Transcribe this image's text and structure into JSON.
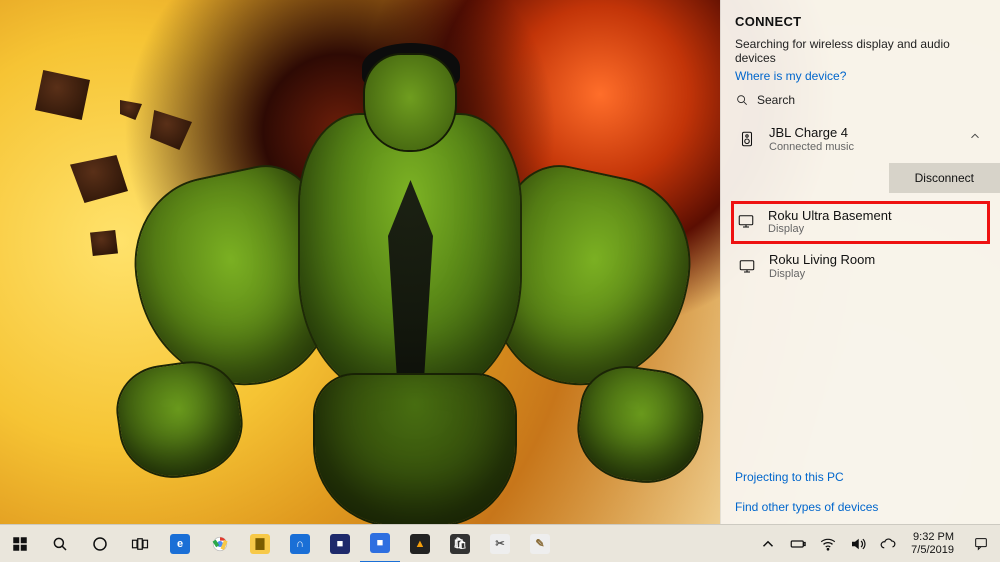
{
  "panel": {
    "title": "CONNECT",
    "status_text": "Searching for wireless display and audio devices",
    "where_link": "Where is my device?",
    "search_label": "Search",
    "connected_device": {
      "name": "JBL Charge 4",
      "sub": "Connected music"
    },
    "disconnect_label": "Disconnect",
    "devices": [
      {
        "name": "Roku Ultra Basement",
        "sub": "Display",
        "highlighted": true
      },
      {
        "name": "Roku Living Room",
        "sub": "Display",
        "highlighted": false
      }
    ],
    "projecting_link": "Projecting to this PC",
    "other_types_link": "Find other types of devices"
  },
  "taskbar": {
    "pinned": [
      {
        "name": "start",
        "glyph": "win",
        "color": "#111"
      },
      {
        "name": "search",
        "glyph": "search",
        "color": "#111"
      },
      {
        "name": "cortana",
        "glyph": "ring",
        "color": "#111"
      },
      {
        "name": "task-view",
        "glyph": "taskview",
        "color": "#111"
      },
      {
        "name": "edge",
        "glyph": "E",
        "color": "#1a6fd6"
      },
      {
        "name": "chrome",
        "glyph": "●",
        "color": "#fff"
      },
      {
        "name": "file-explorer",
        "glyph": "▇",
        "color": "#f7c948"
      },
      {
        "name": "app-blue",
        "glyph": "∩",
        "color": "#1a6fd6"
      },
      {
        "name": "app-dark",
        "glyph": "■",
        "color": "#1e2a6b"
      },
      {
        "name": "app-blue2",
        "glyph": "■",
        "color": "#2e6fe0"
      },
      {
        "name": "app-warning",
        "glyph": "▲",
        "color": "#f59e0b"
      },
      {
        "name": "ms-store",
        "glyph": "🛍",
        "color": "#333"
      },
      {
        "name": "snip",
        "glyph": "✂",
        "color": "#777"
      },
      {
        "name": "app-feather",
        "glyph": "✎",
        "color": "#8a6d3b"
      }
    ],
    "tray": {
      "items": [
        "tray-up",
        "battery",
        "wifi",
        "volume",
        "onedrive"
      ],
      "time": "9:32 PM",
      "date": "7/5/2019"
    }
  }
}
